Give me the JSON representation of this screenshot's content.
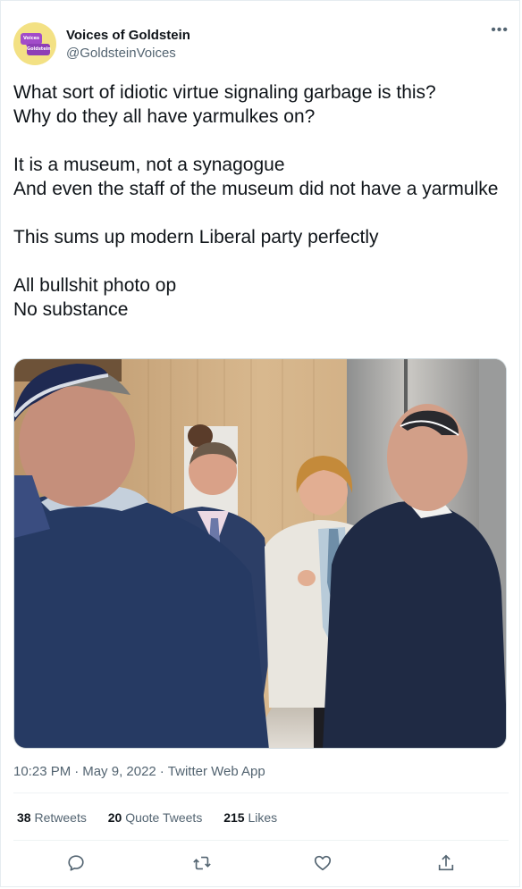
{
  "author": {
    "name": "Voices of Goldstein",
    "handle": "@GoldsteinVoices",
    "avatar_text_top": "Voices of",
    "avatar_text_bottom": "Goldstein",
    "avatar_bg": "#f3e184",
    "avatar_accent": "#a24cc9"
  },
  "more_icon": "more-horizontal-icon",
  "tweet": {
    "text": "What sort of idiotic virtue signaling garbage is this?\nWhy do they all have yarmulkes on?\n\nIt is a museum, not a synagogue\nAnd even the staff of the museum did not have a yarmulke\n\nThis sums up modern Liberal party perfectly\n\nAll bullshit photo op\nNo substance",
    "time": "10:23 PM",
    "date": "May 9, 2022",
    "source": "Twitter Web App",
    "separator": "·"
  },
  "stats": {
    "retweets_count": "38",
    "retweets_label": "Retweets",
    "quotes_count": "20",
    "quotes_label": "Quote Tweets",
    "likes_count": "215",
    "likes_label": "Likes"
  },
  "actions": [
    {
      "name": "reply",
      "icon": "reply-icon"
    },
    {
      "name": "retweet",
      "icon": "retweet-icon"
    },
    {
      "name": "like",
      "icon": "heart-icon"
    },
    {
      "name": "share",
      "icon": "share-icon"
    }
  ],
  "colors": {
    "text_primary": "#0f1419",
    "text_secondary": "#536471",
    "border": "#eff3f4"
  }
}
